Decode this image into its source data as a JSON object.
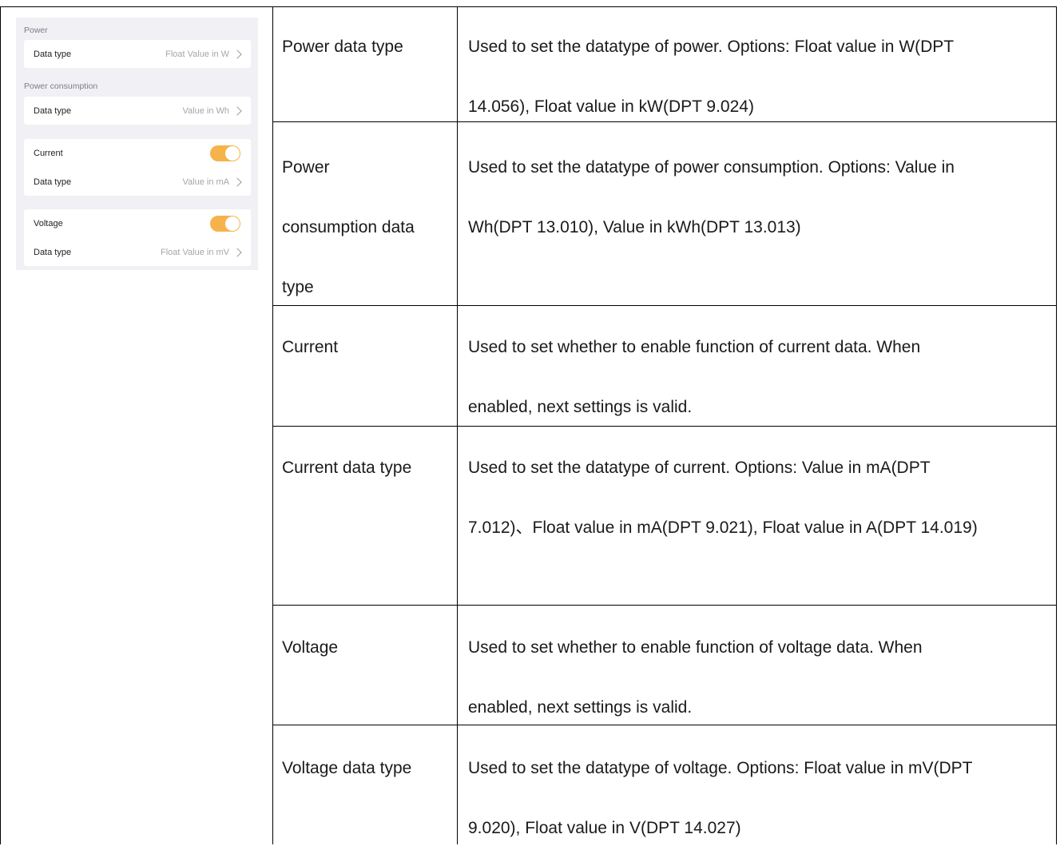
{
  "panel": {
    "power_label": "Power",
    "power_datatype_label": "Data type",
    "power_datatype_value": "Float Value in W",
    "consumption_label": "Power consumption",
    "consumption_datatype_label": "Data type",
    "consumption_datatype_value": "Value in Wh",
    "current_label": "Current",
    "current_enabled": true,
    "current_datatype_label": "Data type",
    "current_datatype_value": "Value in mA",
    "voltage_label": "Voltage",
    "voltage_enabled": true,
    "voltage_datatype_label": "Data type",
    "voltage_datatype_value": "Float Value in mV",
    "toggle_color": "#f6b24b"
  },
  "table": {
    "rows": [
      {
        "param_lines": [
          "Power data type"
        ],
        "desc_lines": [
          "Used to set the datatype of power. Options: Float value in W(DPT",
          "14.056), Float value in kW(DPT 9.024)"
        ]
      },
      {
        "param_lines": [
          "Power",
          "consumption data",
          "type"
        ],
        "desc_lines": [
          "Used to set the datatype of power consumption. Options: Value in",
          "Wh(DPT 13.010), Value in kWh(DPT 13.013)"
        ]
      },
      {
        "param_lines": [
          "Current"
        ],
        "desc_lines": [
          "Used to set whether to enable function of current data. When",
          "enabled, next settings is valid."
        ]
      },
      {
        "param_lines": [
          "Current data type"
        ],
        "desc_lines": [
          "Used to set the datatype of current. Options: Value in mA(DPT",
          "7.012)、Float value in mA(DPT 9.021), Float value in A(DPT 14.019)"
        ]
      },
      {
        "param_lines": [
          "Voltage"
        ],
        "desc_lines": [
          "Used to set whether to enable function of voltage data. When",
          "enabled, next settings is valid."
        ]
      },
      {
        "param_lines": [
          "Voltage data type"
        ],
        "desc_lines": [
          "Used to set the datatype of voltage. Options: Float value in mV(DPT",
          "9.020), Float value in V(DPT 14.027)"
        ]
      }
    ]
  }
}
